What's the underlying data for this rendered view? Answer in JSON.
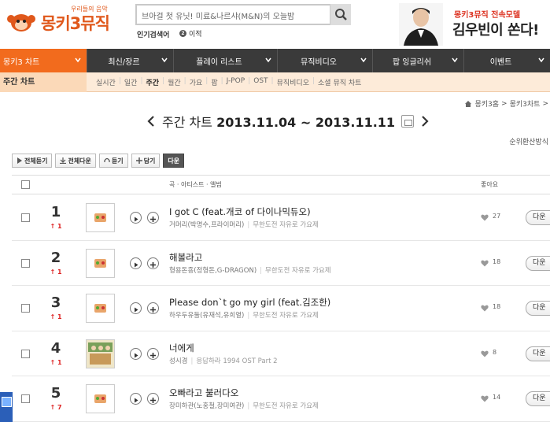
{
  "header": {
    "logo_sub": "우리들의 음악",
    "logo_main": "몽키3뮤직",
    "search_placeholder": "브아걸 첫 유닛! 미료&나르샤(M&N)의 오늘밤",
    "hot_label": "인기검색어",
    "hot_value": "이적",
    "promo_line1": "몽키3뮤직 전속모델",
    "promo_line2": "김우빈이 쏜다!"
  },
  "nav": {
    "items": [
      {
        "label": "몽키3 차트",
        "active": true
      },
      {
        "label": "최신/장르",
        "active": false
      },
      {
        "label": "플레이 리스트",
        "active": false
      },
      {
        "label": "뮤직비디오",
        "active": false
      },
      {
        "label": "팝 잉글리쉬",
        "active": false
      },
      {
        "label": "이벤트",
        "active": false
      }
    ]
  },
  "subnav": {
    "title": "주간 차트",
    "items": [
      "실시간",
      "일간",
      "주간",
      "월간",
      "가요",
      "팝",
      "J-POP",
      "OST",
      "뮤직비디오",
      "소셜 뮤직 차트"
    ],
    "active_index": 2
  },
  "breadcrumb": {
    "items": [
      "몽키3홈",
      "몽키3차트"
    ]
  },
  "date_nav": {
    "label": "주간 차트",
    "range": "2013.11.04 ~ 2013.11.11"
  },
  "rank_method": "순위환산방식",
  "toolbar": {
    "play_all": "전체듣기",
    "download_all": "전체다운",
    "listen": "듣기",
    "add": "담기",
    "download": "다운"
  },
  "table": {
    "col_song": "곡 · 아티스트 · 앨범",
    "col_like": "좋아요",
    "download_label": "다운",
    "rows": [
      {
        "rank": "1",
        "change": "1",
        "title": "I got C (feat.개코 of 다이나믹듀오)",
        "artist": "거머리(박명수,프라이머리)",
        "album": "무한도전 자유로 가요제",
        "likes": "27"
      },
      {
        "rank": "2",
        "change": "1",
        "title": "해볼라고",
        "artist": "형용돈죵(정형돈,G-DRAGON)",
        "album": "무한도전 자유로 가요제",
        "likes": "18"
      },
      {
        "rank": "3",
        "change": "1",
        "title": "Please don`t go my girl (feat.김조한)",
        "artist": "하우두유둘(유재석,유희열)",
        "album": "무한도전 자유로 가요제",
        "likes": "18"
      },
      {
        "rank": "4",
        "change": "1",
        "title": "너에게",
        "artist": "성시경",
        "album": "응답하라 1994 OST Part 2",
        "likes": "8"
      },
      {
        "rank": "5",
        "change": "7",
        "title": "오빠라고 불러다오",
        "artist": "장미하관(노홍철,장미여관)",
        "album": "무한도전 자유로 가요제",
        "likes": "14"
      }
    ]
  },
  "colors": {
    "brand_orange": "#e0581b",
    "nav_active": "#f26b1d",
    "nav_bg": "#3a3a3a",
    "rank_up": "#d22"
  }
}
